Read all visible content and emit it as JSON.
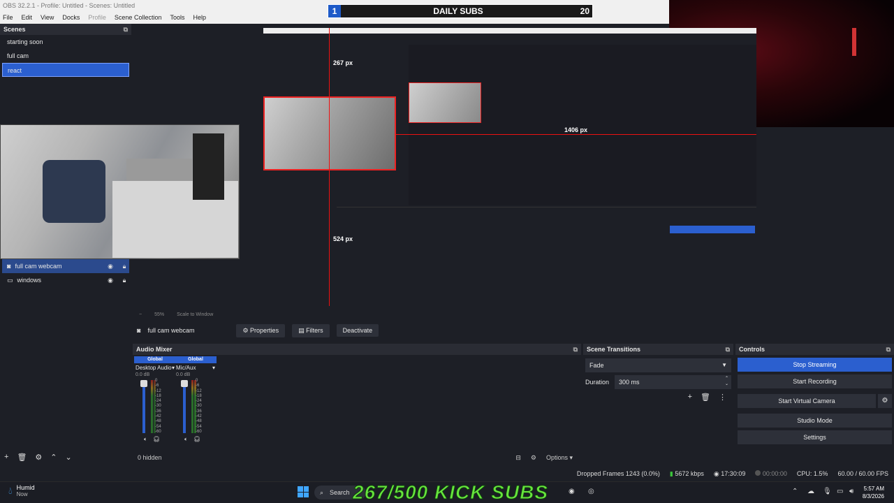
{
  "window": {
    "title": "OBS 32.2.1 - Profile: Untitled - Scenes: Untitled"
  },
  "menu": [
    "File",
    "Edit",
    "View",
    "Docks",
    "Profile",
    "Scene Collection",
    "Tools",
    "Help"
  ],
  "overlay_daily": {
    "left_num": "1",
    "label": "DAILY SUBS",
    "right_num": "20"
  },
  "scenes": {
    "title": "Scenes",
    "items": [
      "starting soon",
      "full cam",
      "react"
    ],
    "active_index": 2
  },
  "sources": {
    "items": [
      {
        "name": "full cam webcam",
        "icon": "camera-icon"
      },
      {
        "name": "windows",
        "icon": "window-icon"
      }
    ]
  },
  "preview": {
    "inner_title": "OBS 32.2.1 - Profile: Untitled - Scenes: Untitled",
    "label_267": "267 px",
    "label_1406": "1406 px",
    "label_524": "524 px",
    "zoom": "55%",
    "scale_mode": "Scale to Window"
  },
  "source_toolbar": {
    "selected": "full cam webcam",
    "properties": "Properties",
    "filters": "Filters",
    "deactivate": "Deactivate"
  },
  "mixer": {
    "title": "Audio Mixer",
    "channels": [
      {
        "global": "Global",
        "name": "Desktop Audio",
        "db": "0.0 dB"
      },
      {
        "global": "Global",
        "name": "Mic/Aux",
        "db": "0.0 dB"
      }
    ],
    "scale": [
      "0",
      "-6",
      "-12",
      "-18",
      "-24",
      "-30",
      "-36",
      "-42",
      "-48",
      "-54",
      "-60"
    ],
    "hidden": "0 hidden",
    "options": "Options"
  },
  "transitions": {
    "title": "Scene Transitions",
    "type": "Fade",
    "duration_label": "Duration",
    "duration_value": "300 ms"
  },
  "controls": {
    "title": "Controls",
    "stop_streaming": "Stop Streaming",
    "start_recording": "Start Recording",
    "start_virtual_camera": "Start Virtual Camera",
    "studio_mode": "Studio Mode",
    "settings": "Settings"
  },
  "status": {
    "dropped": "Dropped Frames 1243 (0.0%)",
    "kbps": "5672 kbps",
    "stream_time": "17:30:09",
    "rec_time": "00:00:00",
    "cpu": "CPU: 1.5%",
    "fps": "60.00 / 60.00 FPS"
  },
  "taskbar": {
    "weather_title": "Humid",
    "weather_sub": "Now",
    "search": "Search",
    "kick_subs": "267/500 KICK SUBS",
    "time": "5:57 AM",
    "date": "8/3/2026"
  },
  "colors": {
    "accent": "#2b5fcf",
    "highlight_red": "#e11111",
    "kick_green": "#67e43d"
  }
}
